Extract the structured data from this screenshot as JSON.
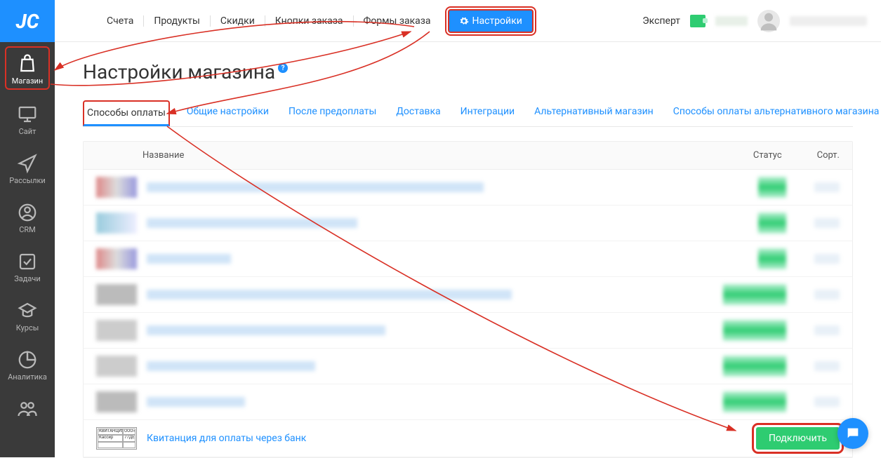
{
  "logo": "JC",
  "sidebar": [
    {
      "key": "shop",
      "label": "Магазин"
    },
    {
      "key": "site",
      "label": "Сайт"
    },
    {
      "key": "mail",
      "label": "Рассылки"
    },
    {
      "key": "crm",
      "label": "CRM"
    },
    {
      "key": "tasks",
      "label": "Задачи"
    },
    {
      "key": "courses",
      "label": "Курсы"
    },
    {
      "key": "analytics",
      "label": "Аналитика"
    }
  ],
  "top_menu": {
    "invoices": "Счета",
    "products": "Продукты",
    "discounts": "Скидки",
    "order_buttons": "Кнопки заказа",
    "order_forms": "Формы заказа",
    "settings": "Настройки"
  },
  "header_right": {
    "expert": "Эксперт"
  },
  "page": {
    "title": "Настройки магазина"
  },
  "tabs": {
    "payment_methods": "Способы оплаты",
    "general": "Общие настройки",
    "after_prepay": "После предоплаты",
    "delivery": "Доставка",
    "integrations": "Интеграции",
    "alt_store": "Альтернативный магазин",
    "alt_store_payments": "Способы оплаты альтернативного магазина"
  },
  "table": {
    "columns": {
      "name": "Название",
      "status": "Статус",
      "sort": "Сорт."
    },
    "bank_receipt_label": "Квитанция для оплаты через банк",
    "connect_btn": "Подключить",
    "thumb": {
      "k": "КВИТАНЦИЯ",
      "o": "ООО»",
      "c": "Кассир",
      "t": "77ДЕ"
    }
  }
}
